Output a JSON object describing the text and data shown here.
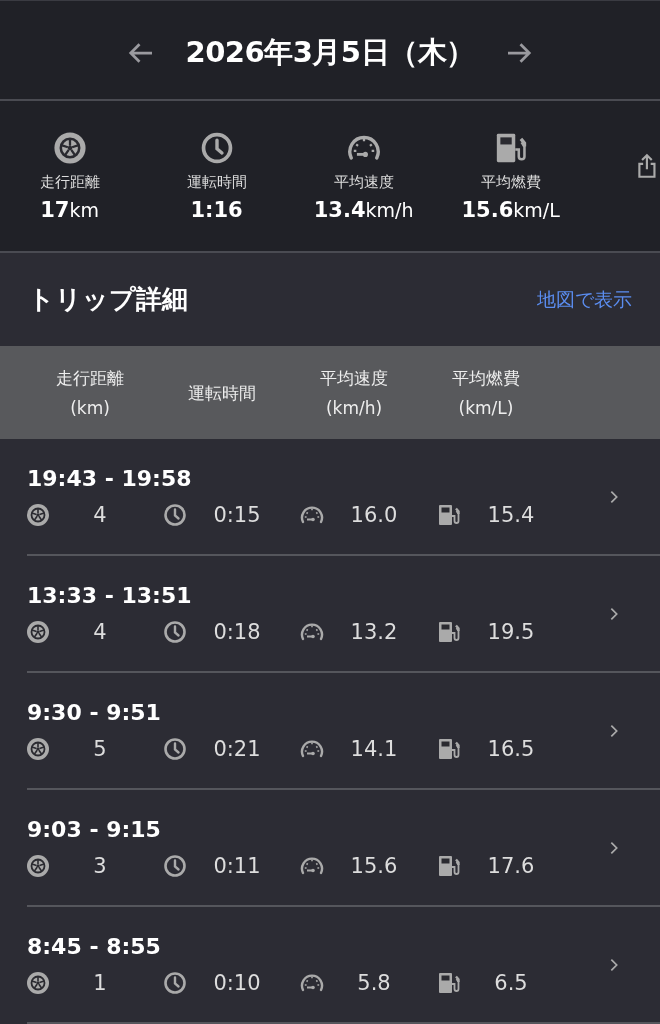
{
  "date_nav": {
    "date": "2026年3月5日（木）"
  },
  "summary": [
    {
      "kind": "distance",
      "label": "走行距離",
      "value": "**17**km"
    },
    {
      "kind": "time",
      "label": "運転時間",
      "value": "**1:16**"
    },
    {
      "kind": "speed",
      "label": "平均速度",
      "value": "**13.4**km/h"
    },
    {
      "kind": "fuel",
      "label": "平均燃費",
      "value": "**15.6**km/L"
    }
  ],
  "trips_header": {
    "title": "トリップ詳細",
    "link": "地図で表示"
  },
  "table": {
    "columns": [
      [
        "走行距離",
        "(km)"
      ],
      [
        "運転時間"
      ],
      [
        "平均速度",
        "(km/h)"
      ],
      [
        "平均燃費",
        "(km/L)"
      ]
    ],
    "rows": [
      {
        "time": "19:43 - 19:58",
        "distance": "4",
        "duration": "0:15",
        "speed": "16.0",
        "fuel": "15.4"
      },
      {
        "time": "13:33 - 13:51",
        "distance": "4",
        "duration": "0:18",
        "speed": "13.2",
        "fuel": "19.5"
      },
      {
        "time": "9:30 - 9:51",
        "distance": "5",
        "duration": "0:21",
        "speed": "14.1",
        "fuel": "16.5"
      },
      {
        "time": "9:03 - 9:15",
        "distance": "3",
        "duration": "0:11",
        "speed": "15.6",
        "fuel": "17.6"
      },
      {
        "time": "8:45 - 8:55",
        "distance": "1",
        "duration": "0:10",
        "speed": "5.8",
        "fuel": "6.5"
      }
    ]
  }
}
